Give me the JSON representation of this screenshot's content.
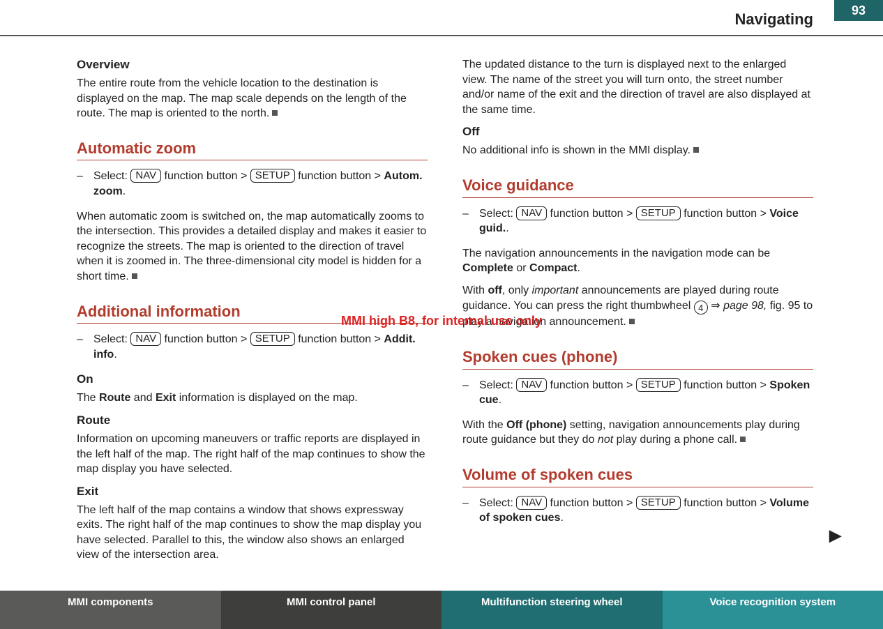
{
  "header": {
    "title": "Navigating",
    "page": "93"
  },
  "watermark": "MMI high B8, for internal use only",
  "left": {
    "overview": {
      "heading": "Overview",
      "body": "The entire route from the vehicle location to the destination is displayed on the map. The map scale depends on the length of the route. The map is oriented to the north."
    },
    "autozoom": {
      "title": "Automatic zoom",
      "step_pre": "Select: ",
      "btn1": "NAV",
      "step_mid": " function button > ",
      "btn2": "SETUP",
      "step_post": " function button > ",
      "step_bold": "Autom. zoom",
      "body": "When automatic zoom is switched on, the map automatically zooms to the intersection. This provides a detailed display and makes it easier to recognize the streets. The map is oriented to the direction of travel when it is zoomed in. The three-dimensional city model is hidden for a short time."
    },
    "addinfo": {
      "title": "Additional information",
      "step_pre": "Select: ",
      "btn1": "NAV",
      "step_mid": " function button > ",
      "btn2": "SETUP",
      "step_post": " function button > ",
      "step_bold": "Addit. info",
      "on_h": "On",
      "on_b_pre": "The ",
      "on_b_b1": "Route",
      "on_b_mid": " and ",
      "on_b_b2": "Exit",
      "on_b_post": " information is displayed on the map.",
      "route_h": "Route",
      "route_b": "Information on upcoming maneuvers or traffic reports are displayed in the left half of the map. The right half of the map continues to show the map display you have selected.",
      "exit_h": "Exit",
      "exit_b": "The left half of the map contains a window that shows expressway exits. The right half of the map continues to show the map display you have selected. Parallel to this, the window also shows an enlarged view of the intersection area."
    }
  },
  "right": {
    "topcarry": "The updated distance to the turn is displayed next to the enlarged view. The name of the street you will turn onto, the street number and/or name of the exit and the direction of travel are also displayed at the same time.",
    "off_h": "Off",
    "off_b": "No additional info is shown in the MMI display.",
    "voice": {
      "title": "Voice guidance",
      "step_pre": "Select: ",
      "btn1": "NAV",
      "step_mid": " function button > ",
      "btn2": "SETUP",
      "step_post": " function button > ",
      "step_bold": "Voice guid.",
      "p1_pre": "The navigation announcements in the navigation mode can be ",
      "p1_b1": "Complete",
      "p1_mid": " or ",
      "p1_b2": "Compact",
      "p2_pre": "With ",
      "p2_b": "off",
      "p2_mid": ", only ",
      "p2_i": "important",
      "p2_post": " announcements are played during route guidance. You can press the right thumbwheel ",
      "p2_circ": "4",
      "p2_link": "page 98,",
      "p2_tail": " fig. 95 to play a navigation announcement."
    },
    "spoken": {
      "title": "Spoken cues (phone)",
      "step_pre": "Select: ",
      "btn1": "NAV",
      "step_mid": " function button > ",
      "btn2": "SETUP",
      "step_post": " function button > ",
      "step_bold": "Spoken cue",
      "p_pre": "With the ",
      "p_b": "Off (phone)",
      "p_mid": " setting, navigation announcements play during route guidance but they do ",
      "p_i": "not",
      "p_post": " play during a phone call."
    },
    "volume": {
      "title": "Volume of spoken cues",
      "step_pre": "Select: ",
      "btn1": "NAV",
      "step_mid": " function button > ",
      "btn2": "SETUP",
      "step_post": " function button > ",
      "step_bold": "Volume of spoken cues"
    }
  },
  "footer": {
    "t1": "MMI components",
    "t2": "MMI control panel",
    "t3": "Multifunction steering wheel",
    "t4": "Voice recognition system"
  }
}
